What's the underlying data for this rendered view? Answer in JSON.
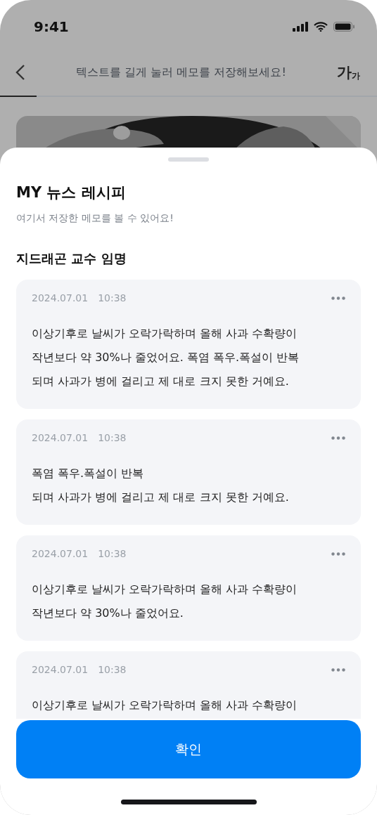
{
  "status_bar": {
    "time": "9:41"
  },
  "header": {
    "title": "텍스트를 길게 눌러 메모를 저장해보세요!",
    "font_size_large": "가",
    "font_size_small": "가"
  },
  "sheet": {
    "title": "MY 뉴스 레시피",
    "subtitle": "여기서 저장한 메모를 볼 수 있어요!",
    "section_title": "지드래곤 교수 임명",
    "memos": [
      {
        "date": "2024.07.01",
        "time": "10:38",
        "text": "이상기후로 날씨가 오락가락하며 올해 사과 수확량이\n작년보다 약 30%나 줄었어요. 폭염 폭우.폭설이 반복\n되며 사과가 병에 걸리고 제 대로 크지 못한 거예요."
      },
      {
        "date": "2024.07.01",
        "time": "10:38",
        "text": "폭염 폭우.폭설이 반복\n되며 사과가 병에 걸리고 제 대로 크지 못한 거예요."
      },
      {
        "date": "2024.07.01",
        "time": "10:38",
        "text": "이상기후로 날씨가 오락가락하며 올해 사과 수확량이\n작년보다 약 30%나 줄었어요."
      },
      {
        "date": "2024.07.01",
        "time": "10:38",
        "text": "이상기후로 날씨가 오락가락하며 올해 사과 수확량이"
      }
    ],
    "confirm_button": "확인"
  }
}
